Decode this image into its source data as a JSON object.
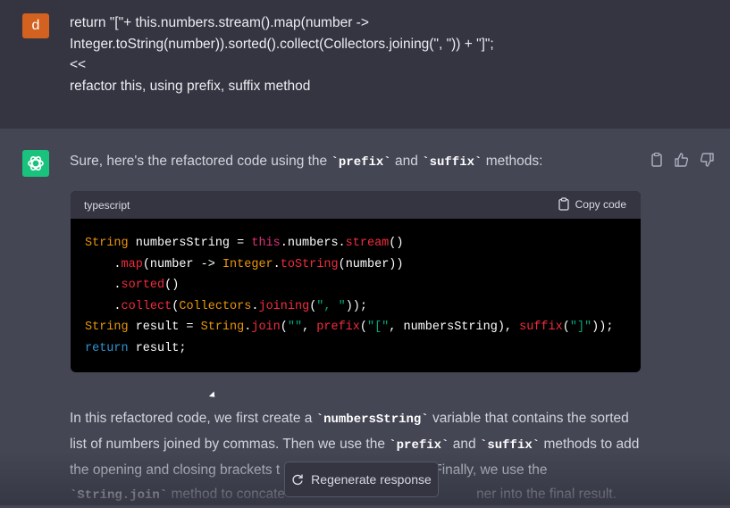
{
  "user_message": {
    "avatar_letter": "d",
    "lines": [
      "return \"[\"+ this.numbers.stream().map(number ->",
      "Integer.toString(number)).sorted().collect(Collectors.joining(\", \")) + \"]\";",
      "<<",
      "refactor this, using prefix, suffix method"
    ]
  },
  "assistant": {
    "intro_before": "Sure, here's the refactored code using the ",
    "intro_code1": "`prefix`",
    "intro_mid": " and ",
    "intro_code2": "`suffix`",
    "intro_after": " methods:",
    "code_lang": "typescript",
    "copy_label": "Copy code",
    "explanation": {
      "p1a": "In this refactored code, we first create a ",
      "p1code": "`numbersString`",
      "p1b": " variable that contains the sorted",
      "p2a": "list of numbers joined by commas. Then we use the ",
      "p2code1": "`prefix`",
      "p2b": " and ",
      "p2code2": "`suffix`",
      "p2c": " methods to add",
      "p3a": "the opening and closing brackets t",
      "p3b": "Finally, we use the",
      "p4code": "`String.join`",
      "p4a": " method to concate",
      "p4b": "ner into the final result."
    }
  },
  "regenerate_label": "Regenerate response",
  "colors": {
    "user_bg": "#343541",
    "assistant_bg": "#444654",
    "user_avatar": "#d3611f",
    "gpt_avatar": "#19c37d"
  }
}
